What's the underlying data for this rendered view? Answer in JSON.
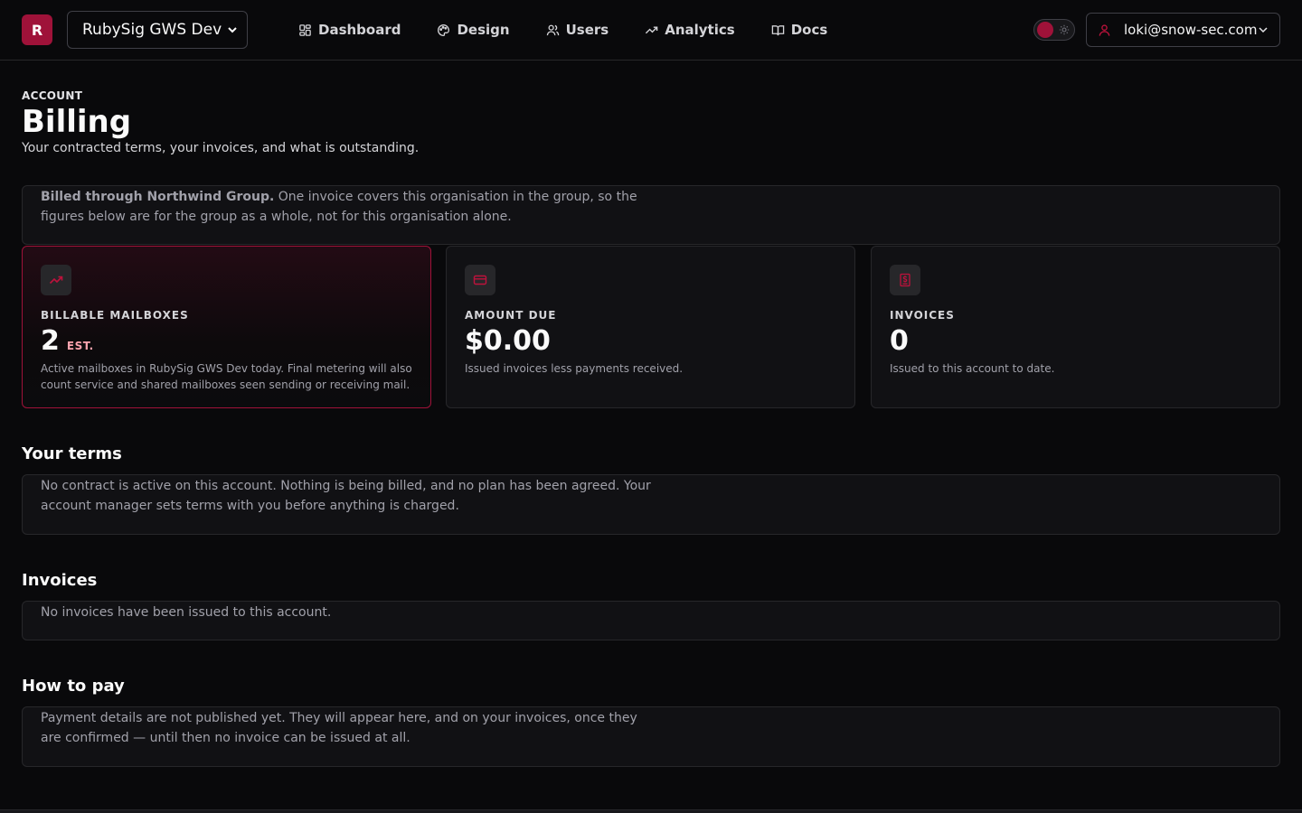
{
  "header": {
    "logo_letter": "R",
    "org_select": {
      "value": "RubySig GWS Dev"
    },
    "nav": [
      {
        "label": "Dashboard",
        "icon": "grid-icon"
      },
      {
        "label": "Design",
        "icon": "palette-icon"
      },
      {
        "label": "Users",
        "icon": "users-icon"
      },
      {
        "label": "Analytics",
        "icon": "trend-icon"
      },
      {
        "label": "Docs",
        "icon": "book-icon"
      }
    ],
    "theme_toggle": {
      "state": "dark"
    },
    "user": {
      "email": "loki@snow-sec.com"
    }
  },
  "page": {
    "eyebrow": "ACCOUNT",
    "title": "Billing",
    "subtitle": "Your contracted terms, your invoices, and what is outstanding."
  },
  "notice": {
    "bold": "Billed through Northwind Group.",
    "text": " One invoice covers this organisation in the group, so the figures below are for the group as a whole, not for this organisation alone."
  },
  "stats": [
    {
      "label": "BILLABLE MAILBOXES",
      "value": "2",
      "suffix": "EST.",
      "description": "Active mailboxes in RubySig GWS Dev today. Final metering will also count service and shared mailboxes seen sending or receiving mail.",
      "icon": "trend-up-icon"
    },
    {
      "label": "AMOUNT DUE",
      "value": "$0.00",
      "suffix": "",
      "description": "Issued invoices less payments received.",
      "icon": "credit-card-icon"
    },
    {
      "label": "INVOICES",
      "value": "0",
      "suffix": "",
      "description": "Issued to this account to date.",
      "icon": "receipt-icon"
    }
  ],
  "terms": {
    "title": "Your terms",
    "text": "No contract is active on this account. Nothing is being billed, and no plan has been agreed. Your account manager sets terms with you before anything is charged."
  },
  "invoices": {
    "title": "Invoices",
    "text": "No invoices have been issued to this account."
  },
  "how_to_pay": {
    "title": "How to pay",
    "text": "Payment details are not published yet. They will appear here, and on your invoices, once they are confirmed — until then no invoice can be issued at all."
  },
  "colors": {
    "accent": "#9f1239",
    "accent_light": "#fda4af",
    "background": "#09090b",
    "surface": "#111114",
    "border": "#27272a"
  }
}
